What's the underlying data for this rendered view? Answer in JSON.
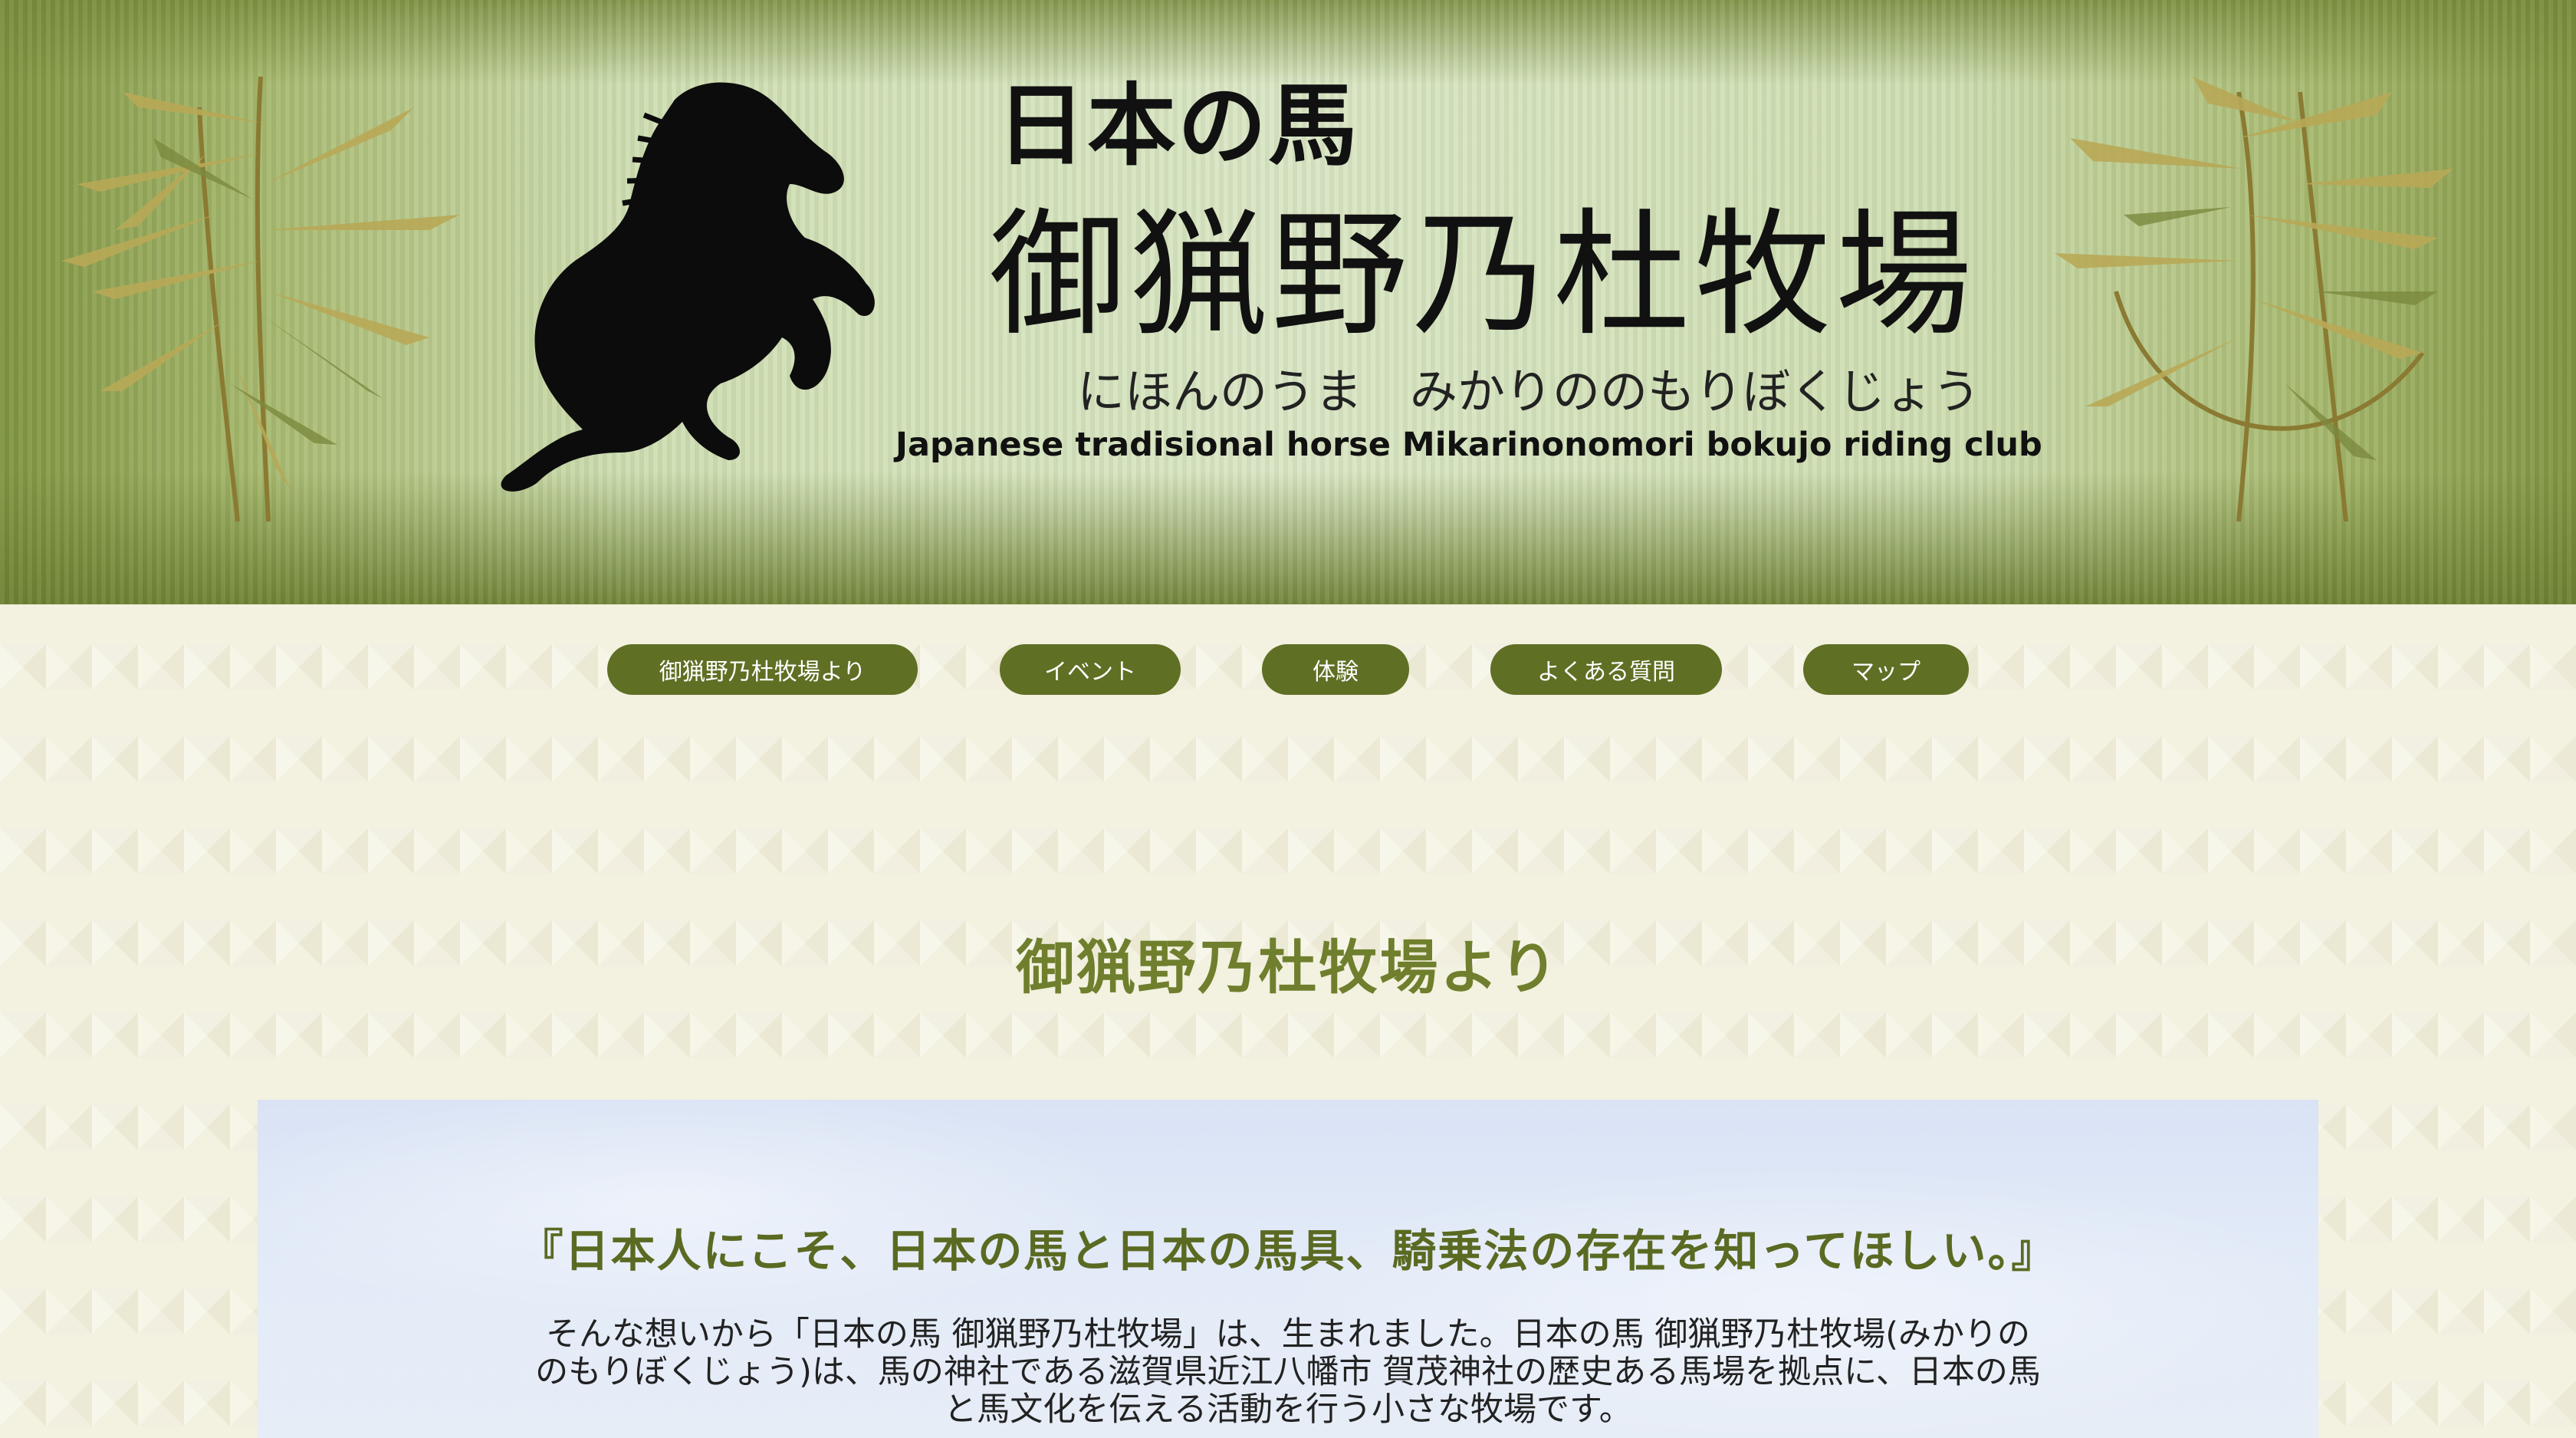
{
  "banner": {
    "title_small": "日本の馬",
    "title_main": "御猟野乃杜牧場",
    "title_kana": "にほんのうま　みかりののもりぼくじょう",
    "title_en": "Japanese tradisional horse Mikarinonomori bokujo riding club"
  },
  "nav": {
    "items": [
      {
        "label": "御猟野乃杜牧場より"
      },
      {
        "label": "イベント"
      },
      {
        "label": "体験"
      },
      {
        "label": "よくある質問"
      },
      {
        "label": "マップ"
      }
    ]
  },
  "main": {
    "section_title": "御猟野乃杜牧場より",
    "headline": "『日本人にこそ、日本の馬と日本の馬具、騎乗法の存在を知ってほしい。』",
    "body": "そんな想いから「日本の馬 御猟野乃杜牧場」は、生まれました。日本の馬 御猟野乃杜牧場(みかりののもりぼくじょう)は、馬の神社である滋賀県近江八幡市 賀茂神社の歴史ある馬場を拠点に、日本の馬と馬文化を伝える活動を行う小さな牧場です。"
  },
  "colors": {
    "nav_bg": "#5f6f24",
    "title_green": "#6f7f2d",
    "headline_green": "#5a6a22"
  }
}
